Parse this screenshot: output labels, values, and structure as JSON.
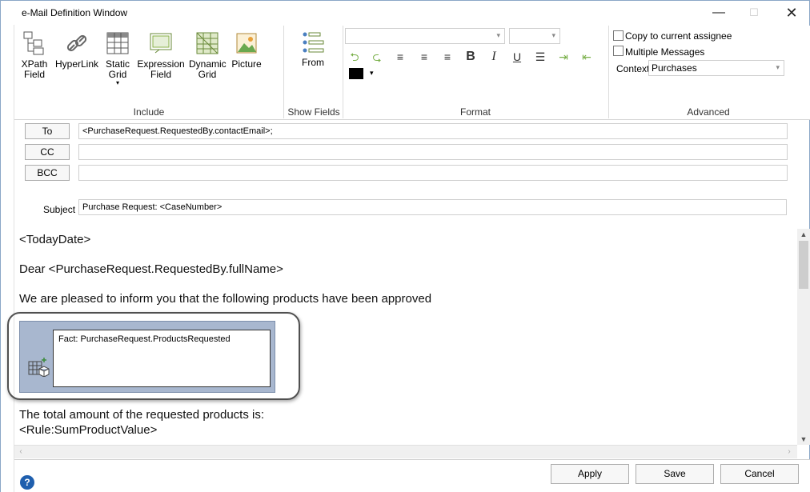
{
  "window": {
    "title": "e-Mail Definition Window",
    "minimize": "—",
    "maximize": "☐",
    "close": "✕"
  },
  "ribbon": {
    "include": {
      "label": "Include",
      "buttons": [
        {
          "label": "XPath\nField",
          "icon": "xpath-field-icon"
        },
        {
          "label": "HyperLink",
          "icon": "hyperlink-icon"
        },
        {
          "label": "Static\nGrid",
          "icon": "static-grid-icon"
        },
        {
          "label": "Expression\nField",
          "icon": "expression-field-icon"
        },
        {
          "label": "Dynamic\nGrid",
          "icon": "dynamic-grid-icon"
        },
        {
          "label": "Picture",
          "icon": "picture-icon"
        }
      ]
    },
    "show_fields": {
      "label": "Show Fields",
      "from_label": "From"
    },
    "format": {
      "label": "Format",
      "font_name": "",
      "font_size": "",
      "bold": "B",
      "italic": "I",
      "underline": "U",
      "color": "#000000"
    },
    "advanced": {
      "label": "Advanced",
      "copy_to_assignee": "Copy to current assignee",
      "multiple_messages": "Multiple Messages",
      "context_label": "Context",
      "context_value": "Purchases"
    }
  },
  "fields": {
    "to_label": "To",
    "to_value": "<PurchaseRequest.RequestedBy.contactEmail>;",
    "cc_label": "CC",
    "cc_value": "",
    "bcc_label": "BCC",
    "bcc_value": "",
    "subject_label": "Subject",
    "subject_value": "Purchase Request: <CaseNumber>"
  },
  "body": {
    "line1": "<TodayDate>",
    "line2": "Dear <PurchaseRequest.RequestedBy.fullName>",
    "line3": "We are pleased to inform you that the following products have been approved",
    "grid_fact": "Fact: PurchaseRequest.ProductsRequested",
    "line4": "The total amount of the requested products is:",
    "line5": "<Rule:SumProductValue>"
  },
  "buttons": {
    "apply": "Apply",
    "save": "Save",
    "cancel": "Cancel",
    "help": "?"
  }
}
